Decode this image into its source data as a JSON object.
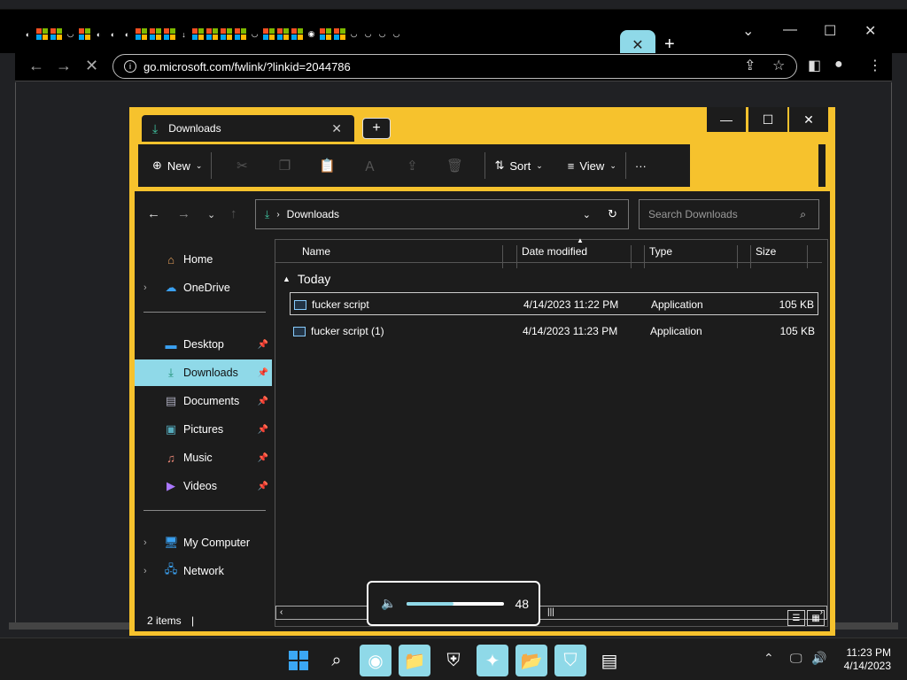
{
  "browser": {
    "url": "go.microsoft.com/fwlink/?linkid=2044786",
    "active_tab_close": "✕",
    "new_tab": "+"
  },
  "explorer": {
    "tab_title": "Downloads",
    "command_bar": {
      "new_label": "New",
      "sort_label": "Sort",
      "view_label": "View",
      "more": "···"
    },
    "address": "Downloads",
    "search_placeholder": "Search Downloads",
    "nav": {
      "home": "Home",
      "onedrive": "OneDrive",
      "desktop": "Desktop",
      "downloads": "Downloads",
      "documents": "Documents",
      "pictures": "Pictures",
      "music": "Music",
      "videos": "Videos",
      "my_computer": "My Computer",
      "network": "Network"
    },
    "columns": {
      "name": "Name",
      "date": "Date modified",
      "type": "Type",
      "size": "Size"
    },
    "group": "Today",
    "files": [
      {
        "name": "fucker script",
        "date": "4/14/2023 11:22 PM",
        "type": "Application",
        "size": "105 KB"
      },
      {
        "name": "fucker script (1)",
        "date": "4/14/2023 11:23 PM",
        "type": "Application",
        "size": "105 KB"
      }
    ],
    "status": "2 items"
  },
  "volume": {
    "value": "48",
    "level": 0.48
  },
  "taskbar": {
    "time": "11:23 PM",
    "date": "4/14/2023"
  },
  "colors": {
    "accent": "#f6c22d",
    "selection": "#8fd9e8",
    "folder_green": "#3fc3a0"
  }
}
